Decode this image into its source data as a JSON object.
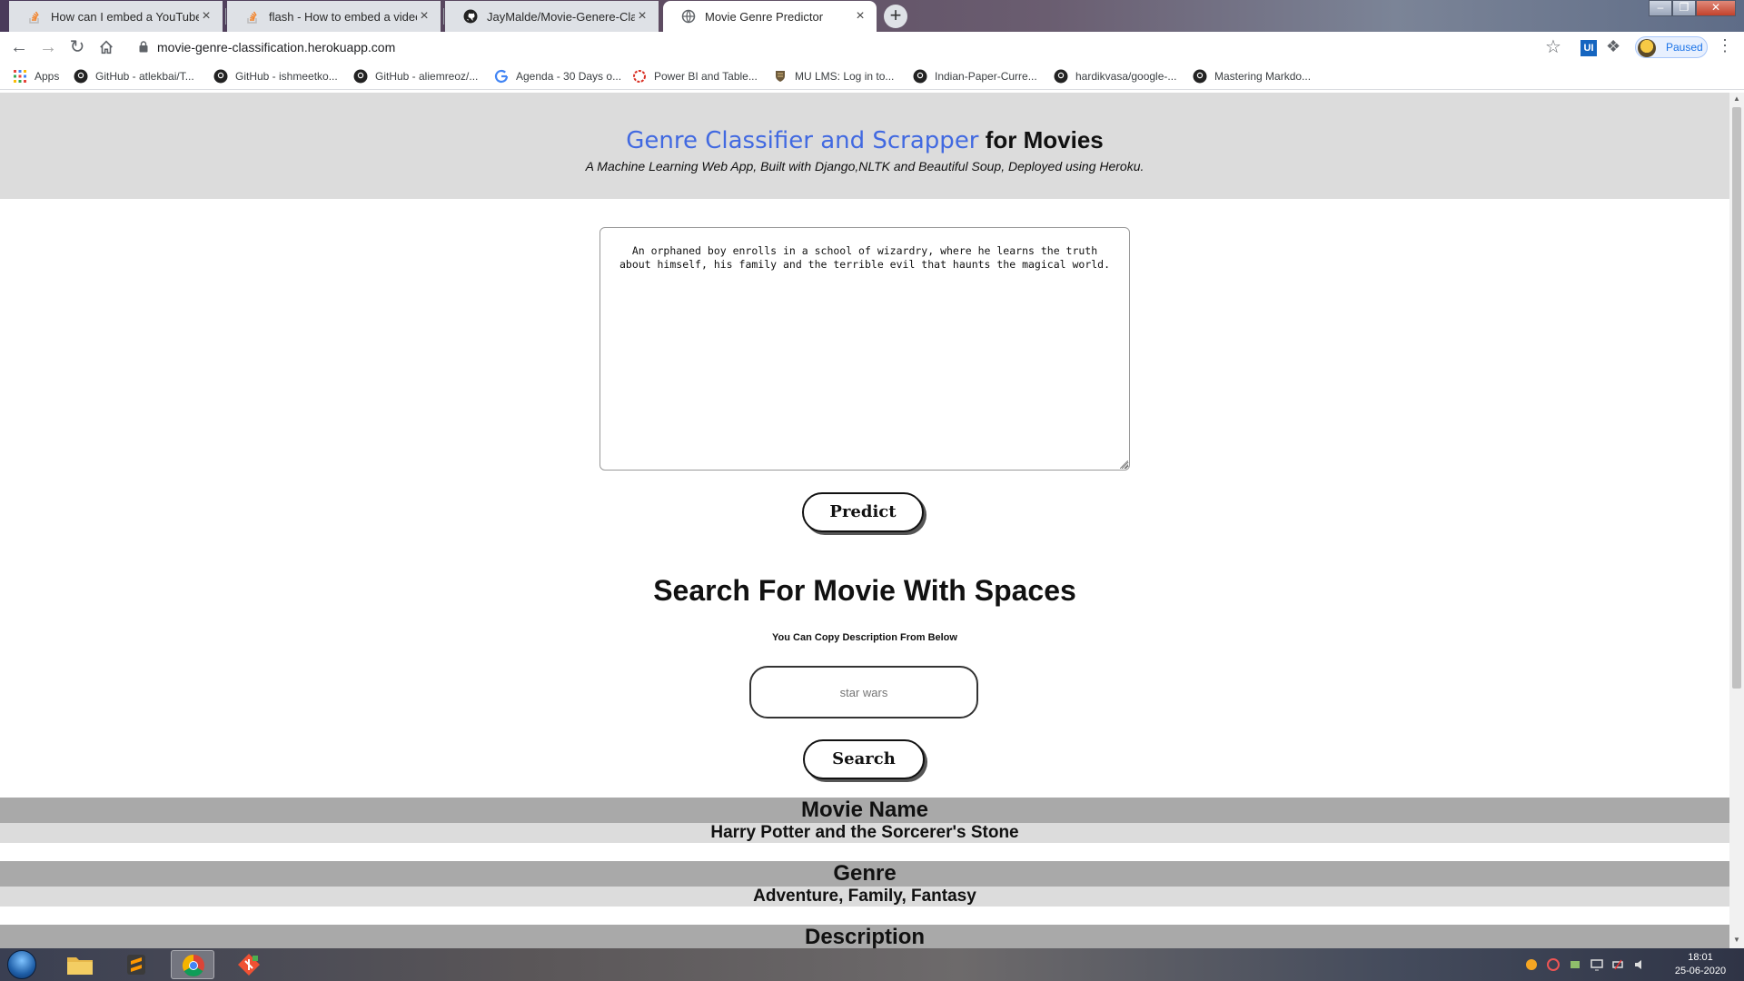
{
  "browser": {
    "tabs": [
      {
        "title": "How can I embed a YouTube vide",
        "icon": "stackoverflow-icon",
        "active": false
      },
      {
        "title": "flash - How to embed a video into",
        "icon": "stackoverflow-icon",
        "active": false
      },
      {
        "title": "JayMalde/Movie-Genere-Classific",
        "icon": "github-icon",
        "active": false
      },
      {
        "title": "Movie Genre Predictor",
        "icon": "globe-icon",
        "active": true
      }
    ],
    "close_glyph": "×",
    "new_tab_glyph": "+",
    "url": "movie-genre-classification.herokuapp.com",
    "profile_status": "Paused",
    "extension_label": "UI",
    "bookmarks": [
      {
        "label": "Apps",
        "icon": "apps-grid-icon"
      },
      {
        "label": "GitHub - atlekbai/T...",
        "icon": "github-icon"
      },
      {
        "label": "GitHub - ishmeetko...",
        "icon": "github-icon"
      },
      {
        "label": "GitHub - aliemreoz/...",
        "icon": "github-icon"
      },
      {
        "label": "Agenda - 30 Days o...",
        "icon": "google-icon"
      },
      {
        "label": "Power BI and Table...",
        "icon": "red-circle-icon"
      },
      {
        "label": "MU LMS: Log in to...",
        "icon": "mu-crest-icon"
      },
      {
        "label": "Indian-Paper-Curre...",
        "icon": "github-icon"
      },
      {
        "label": "hardikvasa/google-...",
        "icon": "github-icon"
      },
      {
        "label": "Mastering Markdo...",
        "icon": "github-icon"
      }
    ]
  },
  "header": {
    "title_part1": "Genre Classifier and Scrapper",
    "title_part2": " for Movies",
    "subtitle": "A Machine Learning Web App, Built with Django,NLTK and Beautiful Soup, Deployed using Heroku."
  },
  "form": {
    "description": "An orphaned boy enrolls in a school of wizardry, where he learns the truth about himself, his family and the terrible evil that haunts the magical world.",
    "predict_label": "Predict"
  },
  "search": {
    "heading": "Search For Movie With Spaces",
    "note": "You Can Copy Description From Below",
    "placeholder": "star wars",
    "button_label": "Search"
  },
  "results": [
    {
      "heading": "Movie Name",
      "value": "Harry Potter and the Sorcerer's Stone"
    },
    {
      "heading": "Genre",
      "value": "Adventure, Family, Fantasy"
    },
    {
      "heading": "Description",
      "value": ""
    }
  ],
  "taskbar": {
    "time": "18:01",
    "date": "25-06-2020"
  }
}
